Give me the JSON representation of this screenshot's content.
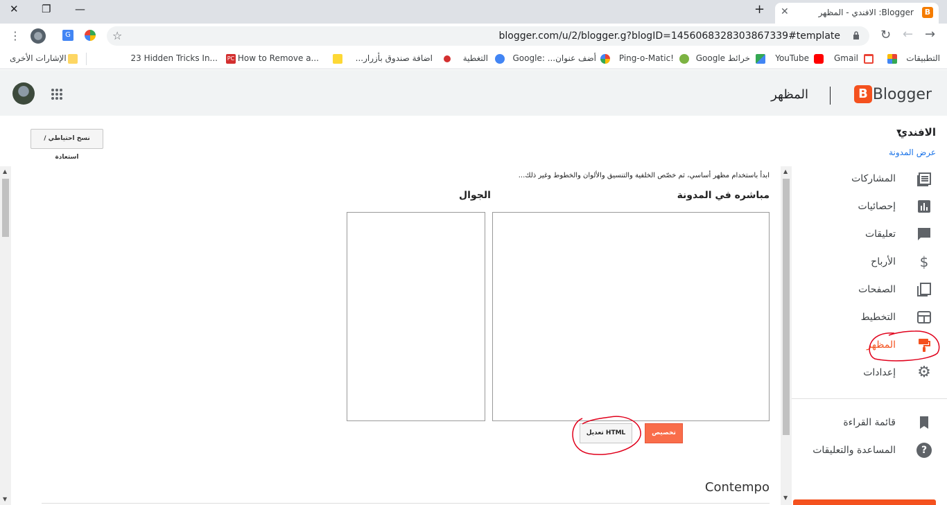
{
  "browser": {
    "tab_title": "Blogger: الافندي - المظهر",
    "tab_favicon": "B",
    "new_tab": "+",
    "close_tab": "✕",
    "url": "blogger.com/u/2/blogger.g?blogID=1456068328303867339#template",
    "bookmarks": [
      {
        "label": "التطبيقات",
        "icon": "apps-icon",
        "color": "#ea4335"
      },
      {
        "label": "Gmail",
        "icon": "gmail-icon",
        "color": "#ea4335"
      },
      {
        "label": "YouTube",
        "icon": "youtube-icon",
        "color": "#ff0000"
      },
      {
        "label": "خرائط Google",
        "icon": "maps-icon",
        "color": "#34a853"
      },
      {
        "label": "Ping-o-Matic!",
        "icon": "pingomatic-icon",
        "color": "#7cb342"
      },
      {
        "label": "أضف عنوان... :Google",
        "icon": "google-icon",
        "color": "#4285f4"
      },
      {
        "label": "التغطية",
        "icon": "coverage-icon",
        "color": "#4285f4"
      },
      {
        "label": "اضافة صندوق بأزرار...",
        "icon": "site-icon",
        "color": "#d32f2f"
      },
      {
        "label": "How to Remove a...",
        "icon": "l-icon",
        "color": "#fdd835"
      },
      {
        "label": "23 Hidden Tricks In...",
        "icon": "pc-icon",
        "color": "#d32f2f"
      }
    ],
    "other_bookmarks": "الإشارات الأخرى"
  },
  "header": {
    "brand": "Blogger",
    "section_title": "المظهر"
  },
  "sidebar": {
    "blog_name": "الافندي",
    "view_blog": "عرض المدونة",
    "items": [
      {
        "label": "المشاركات",
        "icon": "posts-icon"
      },
      {
        "label": "إحصائيات",
        "icon": "stats-icon"
      },
      {
        "label": "تعليقات",
        "icon": "comments-icon"
      },
      {
        "label": "الأرباح",
        "icon": "earnings-icon"
      },
      {
        "label": "الصفحات",
        "icon": "pages-icon"
      },
      {
        "label": "التخطيط",
        "icon": "layout-icon"
      },
      {
        "label": "المظهر",
        "icon": "theme-icon",
        "active": true
      },
      {
        "label": "إعدادات",
        "icon": "settings-icon"
      }
    ],
    "secondary": [
      {
        "label": "قائمة القراءة",
        "icon": "bookmark-icon"
      },
      {
        "label": "المساعدة والتعليقات",
        "icon": "help-icon"
      }
    ]
  },
  "main": {
    "backup_button": "نسخ احتياطي / استعادة",
    "intro": "ابدأ باستخدام مظهر أساسي، ثم خصّص الخلفية والتنسيق والألوان والخطوط وغير ذلك...",
    "live_label": "مباشره في المدونة",
    "mobile_label": "الجوال",
    "customize_button": "تخصيص",
    "edit_html_button": "تعديل HTML",
    "theme_name": "Contempo"
  },
  "colors": {
    "accent": "#f4511e",
    "link": "#1a73e8",
    "annotation": "#e0001b"
  }
}
